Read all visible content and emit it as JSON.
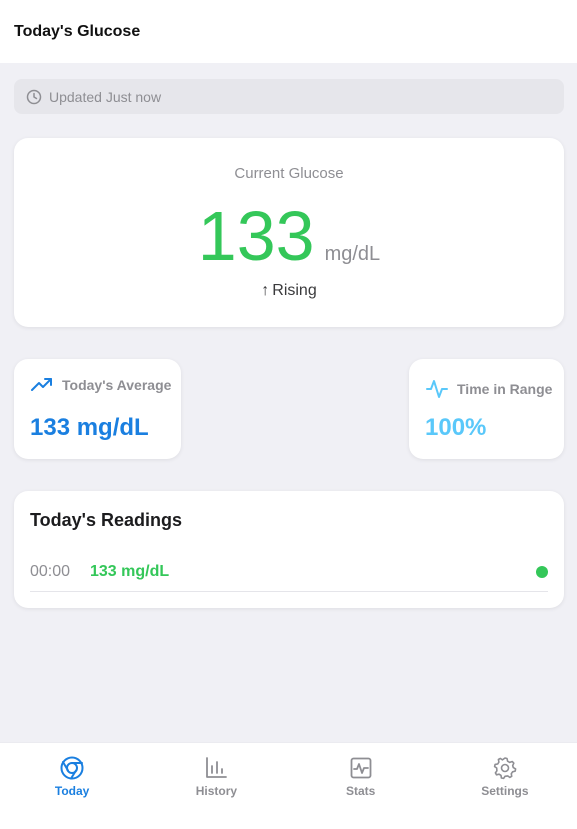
{
  "header": {
    "title": "Today's Glucose"
  },
  "status": {
    "updated_text": "Updated Just now",
    "icon": "clock-icon"
  },
  "current": {
    "label": "Current Glucose",
    "value": "133",
    "unit": "mg/dL",
    "trend_arrow": "↑",
    "trend_label": "Rising",
    "color": "#34c759"
  },
  "stats": {
    "average": {
      "label": "Today's Average",
      "value": "133 mg/dL",
      "icon": "trending-up-icon",
      "color": "#1a7fe0"
    },
    "time_in_range": {
      "label": "Time in Range",
      "value": "100%",
      "icon": "activity-pulse-icon",
      "color": "#5ac8fa"
    }
  },
  "readings": {
    "title": "Today's Readings",
    "items": [
      {
        "time": "00:00",
        "value": "133 mg/dL",
        "status_color": "#34c759"
      }
    ]
  },
  "tabs": [
    {
      "label": "Today",
      "icon": "today-ring-icon",
      "active": true
    },
    {
      "label": "History",
      "icon": "bar-chart-icon",
      "active": false
    },
    {
      "label": "Stats",
      "icon": "stats-pulse-icon",
      "active": false
    },
    {
      "label": "Settings",
      "icon": "gear-icon",
      "active": false
    }
  ]
}
